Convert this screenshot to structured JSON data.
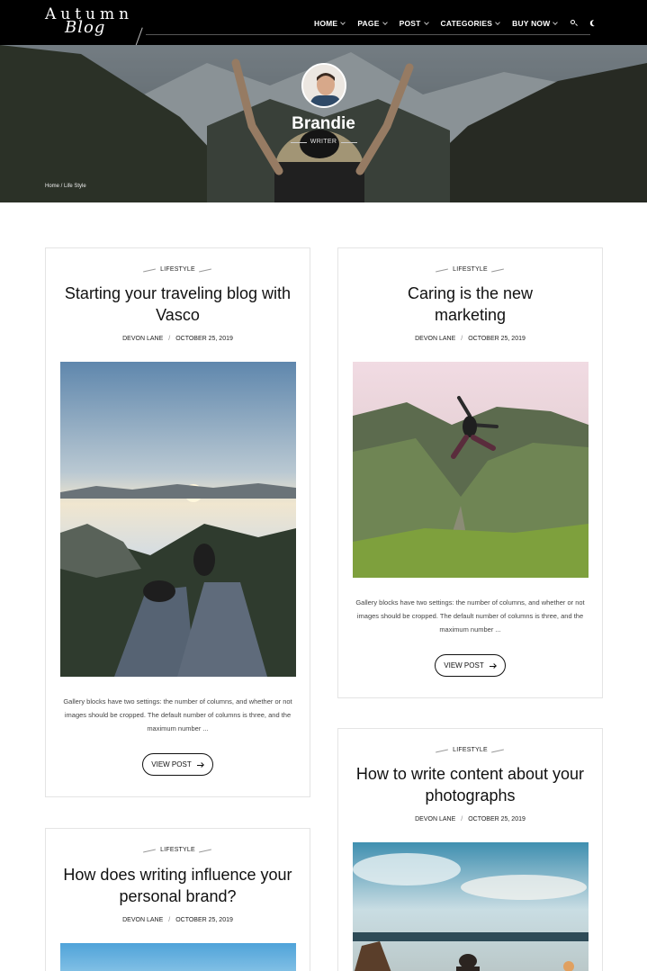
{
  "header": {
    "logo_top": "Autumn",
    "logo_script": "Blog",
    "nav": [
      {
        "label": "HOME"
      },
      {
        "label": "PAGE"
      },
      {
        "label": "POST"
      },
      {
        "label": "CATEGORIES"
      },
      {
        "label": "BUY NOW"
      }
    ]
  },
  "hero": {
    "name": "Brandie",
    "role": "WRITER",
    "breadcrumb_home": "Home",
    "breadcrumb_sep": " / ",
    "breadcrumb_current": "Life Style"
  },
  "posts": [
    {
      "category": "LIFESTYLE",
      "title": "Starting your traveling blog with Vasco",
      "author": "DEVON LANE",
      "date": "OCTOBER 25, 2019",
      "excerpt": "Gallery blocks have two settings: the number of columns, and whether or not images should be cropped. The default number of columns is three, and the maximum number ...",
      "button": "VIEW POST"
    },
    {
      "category": "LIFESTYLE",
      "title": "Caring is the new marketing",
      "author": "DEVON LANE",
      "date": "OCTOBER 25, 2019",
      "excerpt": "Gallery blocks have two settings: the number of columns, and whether or not images should be cropped. The default number of columns is three, and the maximum number ...",
      "button": "VIEW POST"
    },
    {
      "category": "LIFESTYLE",
      "title": "How does writing influence your personal brand?",
      "author": "DEVON LANE",
      "date": "OCTOBER 25, 2019"
    },
    {
      "category": "LIFESTYLE",
      "title": "How to write content about your photographs",
      "author": "DEVON LANE",
      "date": "OCTOBER 25, 2019"
    }
  ],
  "meta_separator": "/",
  "colors": {
    "header_bg": "#000000",
    "card_border": "#e4e4e4",
    "text": "#111111"
  }
}
